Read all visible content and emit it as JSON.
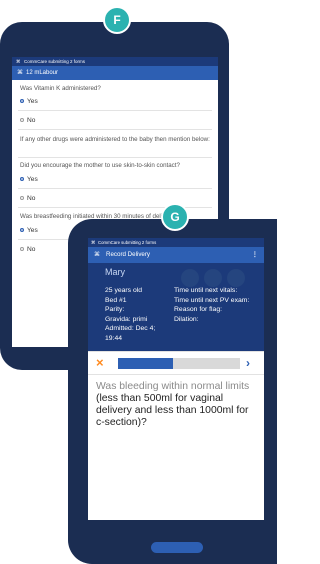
{
  "form_a": {
    "badge": "F",
    "status_text": "CommCare submitting 2 forms",
    "app_title": "12 mLabour",
    "questions": [
      {
        "text": "Was Vitamin K administered?",
        "options": [
          {
            "label": "Yes",
            "selected": true
          },
          {
            "label": "No",
            "selected": false
          }
        ]
      },
      {
        "text": "If any other drugs were administered to the baby then mention below:",
        "options": []
      },
      {
        "text": "Did you encourage the mother to use skin-to-skin contact?",
        "options": [
          {
            "label": "Yes",
            "selected": true
          },
          {
            "label": "No",
            "selected": false
          }
        ]
      },
      {
        "text": "Was breastfeeding initiated within 30 minutes of delivery?",
        "options": [
          {
            "label": "Yes",
            "selected": true
          },
          {
            "label": "No",
            "selected": false
          }
        ]
      }
    ]
  },
  "form_b": {
    "badge": "G",
    "status_text": "CommCare submitting 2 forms",
    "app_title": "Record Delivery",
    "menu_icon": "⋮",
    "patient": {
      "name": "Mary",
      "left_details": [
        "25 years old",
        "Bed #1",
        "Parity:",
        "Gravida: primi",
        "Admitted: Dec 4;",
        "19:44"
      ],
      "right_details": [
        "Time until next vitals:",
        "Time until next PV exam:",
        "Reason for flag:",
        "Dilation:"
      ]
    },
    "nav": {
      "close_icon": "×",
      "next_icon": "›",
      "progress": 0.45
    },
    "question_part1": "Was bleeding within normal limits",
    "question_part2": "(less than 500ml for vaginal delivery and less than 1000ml for c-section)?"
  },
  "colors": {
    "navy": "#1b2d52",
    "blue": "#2d5fb3",
    "teal": "#2bb2b0",
    "orange": "#ff8a1f"
  },
  "icons": {
    "app": "grid-icon"
  }
}
